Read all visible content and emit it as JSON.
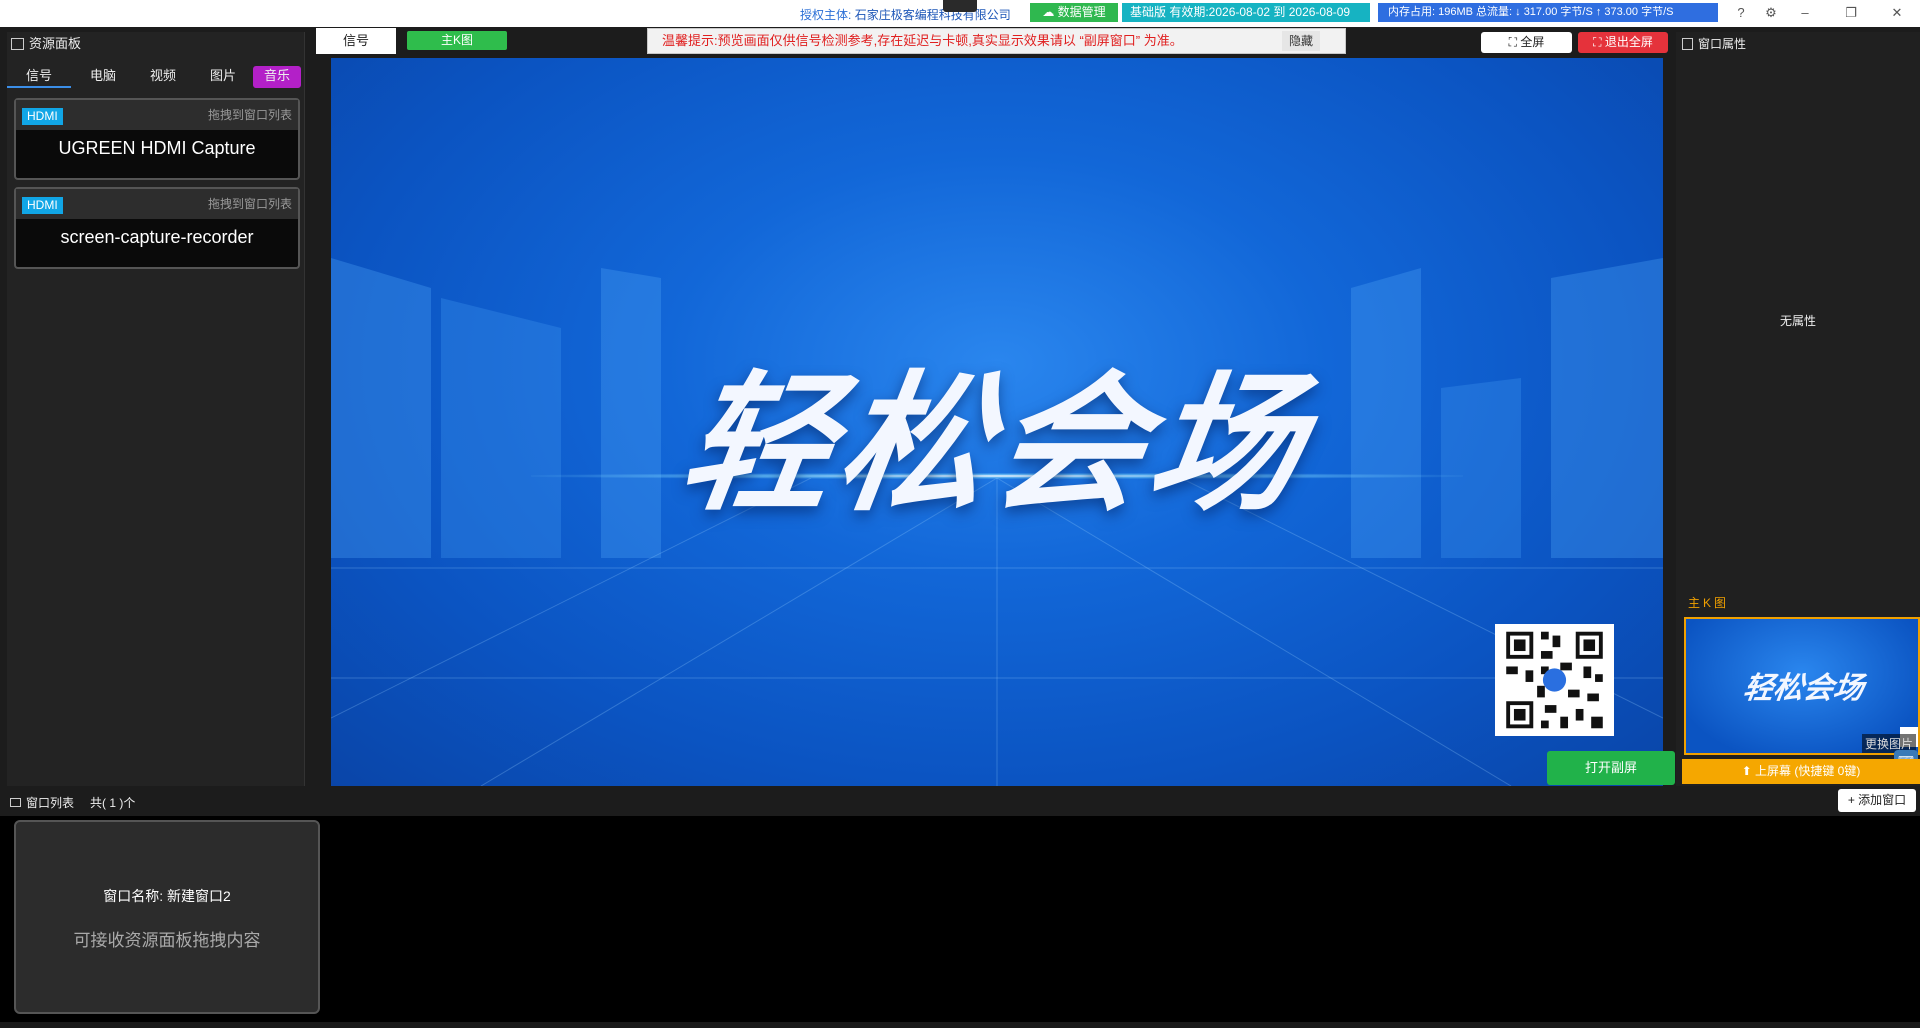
{
  "titlebar": {
    "license_label": "授权主体:",
    "license_value": "石家庄极客编程科技有限公司",
    "data_mgmt": "数据管理",
    "validity": "基础版 有效期:2026-08-02 到 2026-08-09",
    "stats": "内存占用: 196MB  总流量: ↓ 317.00 字节/S  ↑ 373.00 字节/S",
    "help_icon": "?",
    "settings_icon": "⚙",
    "minimize_icon": "–",
    "restore_icon": "❐",
    "close_icon": "✕"
  },
  "left_panel": {
    "title": "资源面板",
    "tabs": [
      {
        "label": "信号"
      },
      {
        "label": "电脑"
      },
      {
        "label": "视频"
      },
      {
        "label": "图片"
      },
      {
        "label": "音乐"
      }
    ],
    "sources": [
      {
        "badge": "HDMI",
        "hint": "拖拽到窗口列表",
        "name": "UGREEN HDMI Capture"
      },
      {
        "badge": "HDMI",
        "hint": "拖拽到窗口列表",
        "name": "screen-capture-recorder"
      }
    ]
  },
  "preview": {
    "tab_signal": "信号",
    "tab_mainK": "主K图",
    "warning": "温馨提示:预览画面仅供信号检测参考,存在延迟与卡顿,真实显示效果请以 “副屏窗口” 为准。",
    "hide_label": "隐藏",
    "fullscreen_label": "全屏",
    "exit_fullscreen_label": "退出全屏",
    "hero_text": "轻松会场",
    "open_sub_screen": "打开副屏"
  },
  "right_panel": {
    "title": "窗口属性",
    "no_property": "无属性",
    "mainK_label": "主K图",
    "thumb_text": "轻松会场",
    "change_image": "更换图片",
    "on_screen": "⬆ 上屏幕 (快捷键 0键)"
  },
  "window_list": {
    "title": "窗口列表",
    "count": "共( 1 )个",
    "add_window": "+ 添加窗口",
    "windows": [
      {
        "name": "窗口名称: 新建窗口2",
        "hint": "可接收资源面板拖拽内容"
      }
    ]
  },
  "colors": {
    "accent_green": "#2fbd4c",
    "accent_red": "#e5323b",
    "accent_orange": "#f5a700",
    "accent_purple": "#b320c8",
    "accent_cyan": "#11a6e6"
  }
}
